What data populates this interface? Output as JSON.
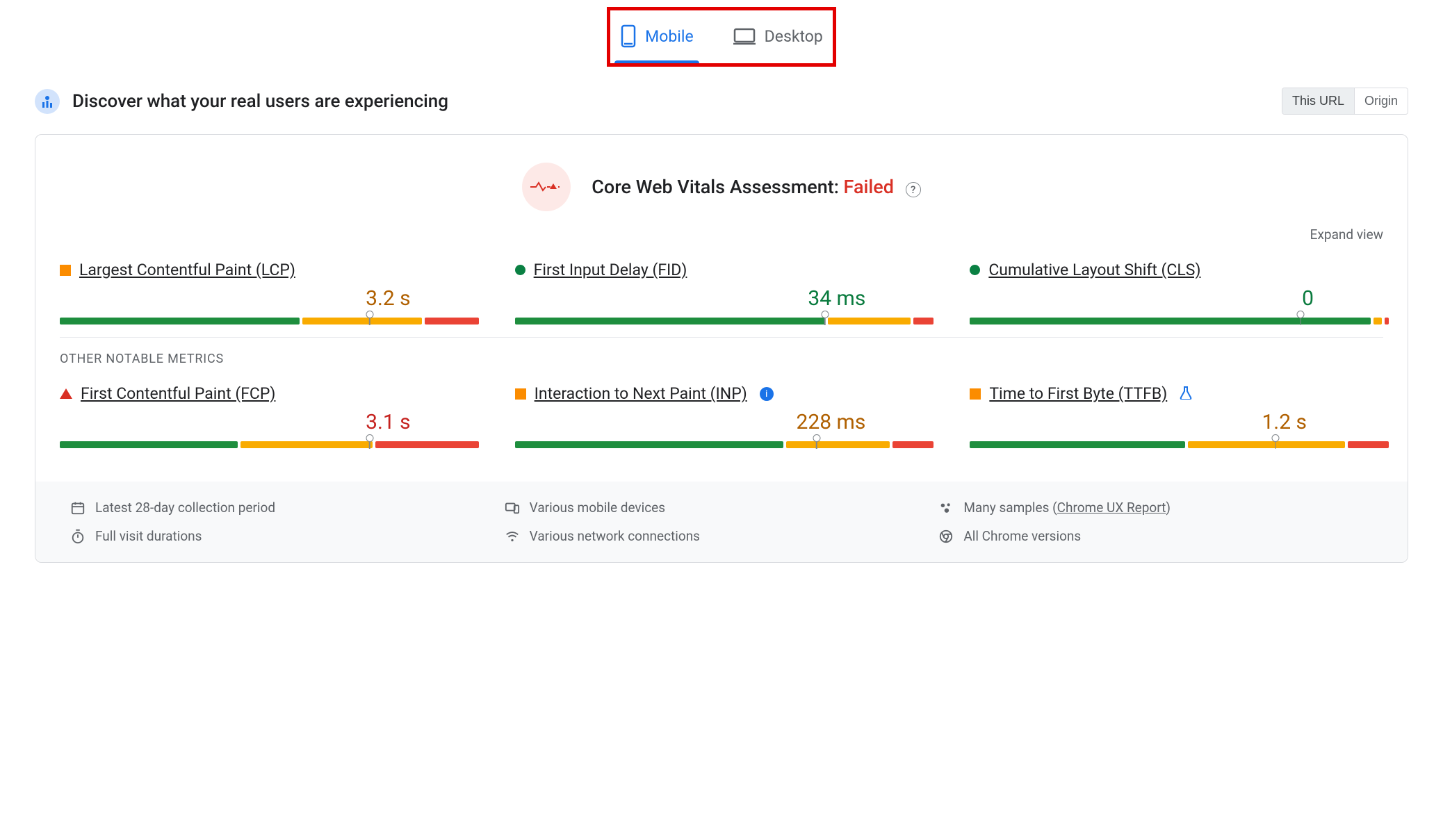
{
  "tabs": {
    "mobile": "Mobile",
    "desktop": "Desktop"
  },
  "header": {
    "title": "Discover what your real users are experiencing",
    "seg_this_url": "This URL",
    "seg_origin": "Origin"
  },
  "assessment": {
    "prefix": "Core Web Vitals Assessment: ",
    "status": "Failed"
  },
  "expand_view": "Expand view",
  "metrics": {
    "lcp": {
      "name": "Largest Contentful Paint (LCP)",
      "value": "3.2 s",
      "bar": {
        "green": 58,
        "orange": 29,
        "red": 13
      },
      "marker_pct": 75
    },
    "fid": {
      "name": "First Input Delay (FID)",
      "value": "34 ms",
      "bar": {
        "green": 75,
        "orange": 20,
        "red": 5
      },
      "marker_pct": 75
    },
    "cls": {
      "name": "Cumulative Layout Shift (CLS)",
      "value": "0",
      "bar": {
        "green": 97,
        "orange": 2,
        "red": 1
      },
      "marker_pct": 80
    },
    "fcp": {
      "name": "First Contentful Paint (FCP)",
      "value": "3.1 s",
      "bar": {
        "green": 43,
        "orange": 32,
        "red": 25
      },
      "marker_pct": 75
    },
    "inp": {
      "name": "Interaction to Next Paint (INP)",
      "value": "228 ms",
      "bar": {
        "green": 65,
        "orange": 25,
        "red": 10
      },
      "marker_pct": 73
    },
    "ttfb": {
      "name": "Time to First Byte (TTFB)",
      "value": "1.2 s",
      "bar": {
        "green": 52,
        "orange": 38,
        "red": 10
      },
      "marker_pct": 74
    }
  },
  "section_label": "OTHER NOTABLE METRICS",
  "footer": {
    "period": "Latest 28-day collection period",
    "devices": "Various mobile devices",
    "samples_prefix": "Many samples (",
    "samples_link": "Chrome UX Report",
    "samples_suffix": ")",
    "duration": "Full visit durations",
    "network": "Various network connections",
    "chrome": "All Chrome versions"
  },
  "colors": {
    "accent": "#1a73e8",
    "green": "#1e8e3e",
    "orange": "#f9ab00",
    "red": "#ea4335"
  }
}
